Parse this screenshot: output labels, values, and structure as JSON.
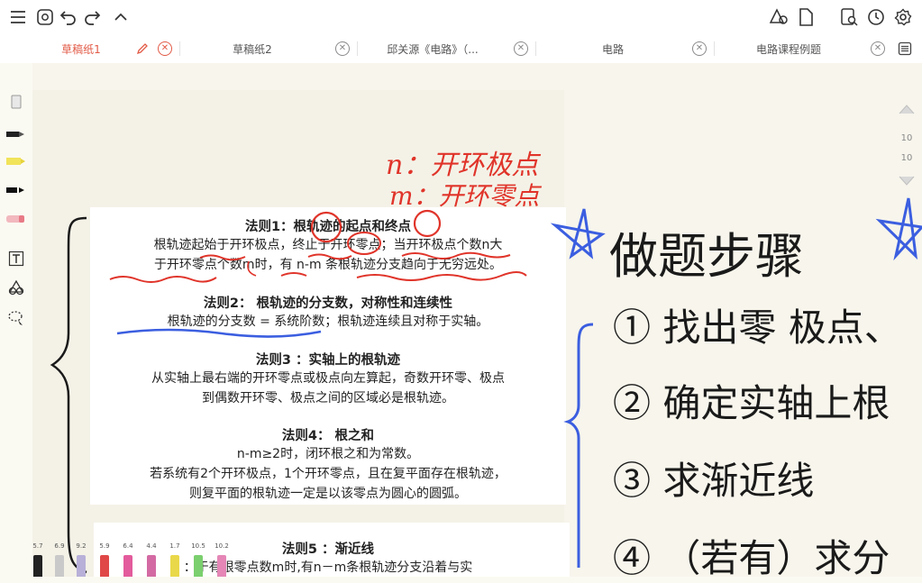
{
  "toolbar": {
    "left_icons": [
      "menu-icon",
      "reader-icon",
      "undo-icon",
      "redo-icon",
      "collapse-icon"
    ],
    "right_icons": [
      "shapes-icon",
      "page-icon",
      "search-doc-icon",
      "history-icon",
      "settings-icon"
    ]
  },
  "tabs": [
    {
      "label": "草稿纸1",
      "active": true
    },
    {
      "label": "草稿纸2",
      "active": false
    },
    {
      "label": "邱关源《电路》（...",
      "active": false
    },
    {
      "label": "电路",
      "active": false
    },
    {
      "label": "电路课程例题",
      "active": false
    }
  ],
  "tools": [
    "eraser-icon",
    "pen-icon",
    "highlighter-icon",
    "marker-icon",
    "eraser-pink-icon",
    "text-icon",
    "shapes-tool-icon",
    "lasso-icon"
  ],
  "right_rail": {
    "values": [
      "10",
      "10"
    ]
  },
  "pens": {
    "sizes": [
      "5.7",
      "6.9",
      "9.2",
      "5.9",
      "6.4",
      "4.4",
      "1.7",
      "10.5",
      "10.2"
    ]
  },
  "doc": {
    "rule1": {
      "heading": "法则1：根轨迹的起点和终点",
      "line1": "根轨迹起始于开环极点，终止于开环零点；当开环极点个数n大",
      "line2": "于开环零点个数m时，有 n-m 条根轨迹分支趋向于无穷远处。"
    },
    "rule2": {
      "heading": "法则2： 根轨迹的分支数，对称性和连续性",
      "line1": "根轨迹的分支数 = 系统阶数；根轨迹连续且对称于实轴。"
    },
    "rule3": {
      "heading": "法则3 ：实轴上的根轨迹",
      "line1": "从实轴上最右端的开环零点或极点向左算起，奇数开环零、极点",
      "line2": "到偶数开环零、极点之间的区域必是根轨迹。"
    },
    "rule4": {
      "heading": "法则4： 根之和",
      "line1": "n-m≥2时，闭环根之和为常数。",
      "line2": "若系统有2个开环极点，1个开环零点，且在复平面存在根轨迹，",
      "line3": "则复平面的根轨迹一定是以该零点为圆心的圆弧。"
    },
    "rule5": {
      "heading": "法则5 ：渐近线",
      "line1": "：于有限零点数m时,有n－m条根轨迹分支沿着与实"
    }
  },
  "handwriting": {
    "note_n": "n：开环极点",
    "note_m": "m：开环零点",
    "title": "做题步骤",
    "step1": "① 找出零 极点、",
    "step2": "② 确定实轴上根",
    "step3": "③ 求渐近线",
    "step4": "④ （若有）求分"
  },
  "colors": {
    "accent": "#e25a46",
    "red_ink": "#e0342a",
    "blue_ink": "#3b5ee0",
    "black_ink": "#1a1a1a"
  }
}
